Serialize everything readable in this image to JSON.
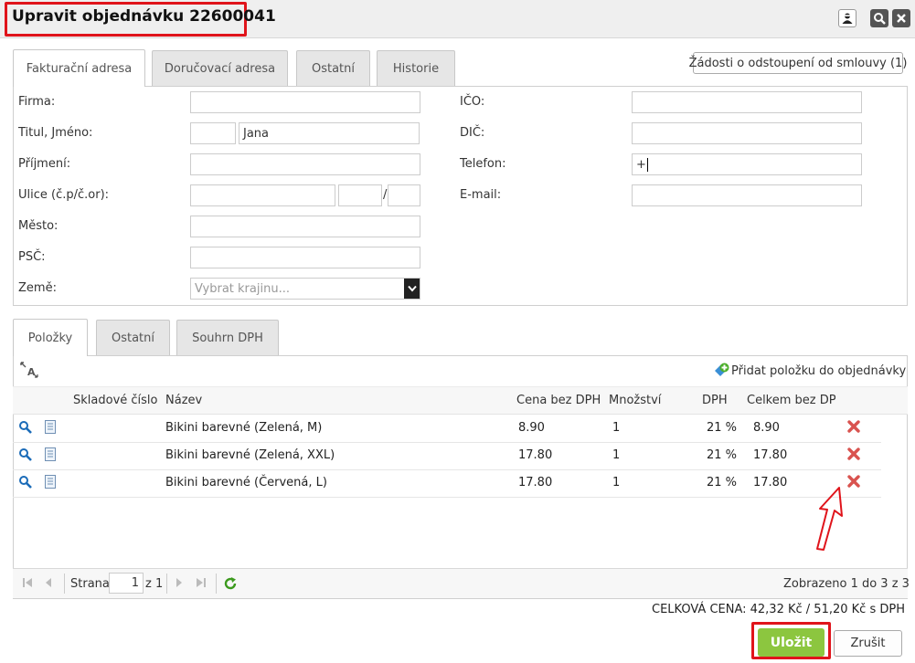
{
  "window": {
    "title": "Upravit objednávku 22600041",
    "icons": [
      "user-icon",
      "search-icon",
      "close-icon"
    ]
  },
  "top_tabs": [
    {
      "label": "Fakturační adresa",
      "active": true
    },
    {
      "label": "Doručovací adresa",
      "active": false
    },
    {
      "label": "Ostatní",
      "active": false
    },
    {
      "label": "Historie",
      "active": false
    }
  ],
  "withdrawal_button": "Žádosti o odstoupení od smlouvy (1)",
  "address_form": {
    "firma": {
      "label": "Firma:",
      "value": ""
    },
    "titul_jmeno": {
      "label": "Titul, Jméno:",
      "titul": "",
      "jmeno": "Jana"
    },
    "prijmeni": {
      "label": "Příjmení:",
      "value": ""
    },
    "ulice": {
      "label": "Ulice (č.p/č.or):",
      "ulice": "",
      "cp": "",
      "separator": "/",
      "cor": ""
    },
    "mesto": {
      "label": "Město:",
      "value": ""
    },
    "psc": {
      "label": "PSČ:",
      "value": ""
    },
    "zeme": {
      "label": "Země:",
      "placeholder": "Vybrat krajinu..."
    },
    "ico": {
      "label": "IČO:",
      "value": ""
    },
    "dic": {
      "label": "DIČ:",
      "value": ""
    },
    "telefon": {
      "label": "Telefon:",
      "value": "+"
    },
    "email": {
      "label": "E-mail:",
      "value": ""
    }
  },
  "bottom_tabs": [
    {
      "label": "Položky",
      "active": true
    },
    {
      "label": "Ostatní",
      "active": false
    },
    {
      "label": "Souhrn DPH",
      "active": false
    }
  ],
  "add_item_label": "Přidat položku do objednávky",
  "items_table": {
    "columns": [
      "Skladové číslo",
      "Název",
      "Cena bez DPH",
      "Množství",
      "DPH",
      "Celkem bez DPH"
    ],
    "rows": [
      {
        "sku": "",
        "name": "Bikini barevné (Zelená, M)",
        "price": "8.90",
        "qty": "1",
        "vat": "21 %",
        "total": "8.90"
      },
      {
        "sku": "",
        "name": "Bikini barevné (Zelená, XXL)",
        "price": "17.80",
        "qty": "1",
        "vat": "21 %",
        "total": "17.80"
      },
      {
        "sku": "",
        "name": "Bikini barevné (Červená, L)",
        "price": "17.80",
        "qty": "1",
        "vat": "21 %",
        "total": "17.80"
      }
    ]
  },
  "pager": {
    "page_label": "Strana",
    "page": "1",
    "of_label": "z 1",
    "summary": "Zobrazeno 1 do 3 z 3"
  },
  "total_price": "CELKOVÁ CENA: 42,32 Kč / 51,20 Kč s DPH",
  "buttons": {
    "save": "Uložit",
    "cancel": "Zrušit"
  },
  "colors": {
    "accent_green": "#8cc63f",
    "annotation_red": "#e0141b",
    "delete_red": "#d9534f",
    "link_blue": "#1a6bb8"
  }
}
